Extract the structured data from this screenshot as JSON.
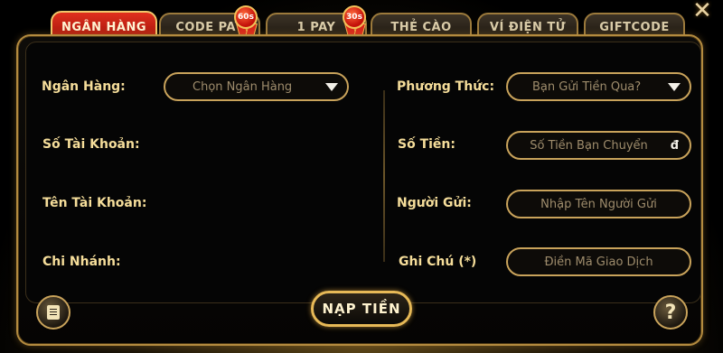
{
  "tabs": [
    {
      "label": "NGÂN HÀNG",
      "active": true
    },
    {
      "label": "CODE PAY",
      "badge": "60s"
    },
    {
      "label": "1 PAY",
      "badge": "30s"
    },
    {
      "label": "THẺ CÀO"
    },
    {
      "label": "VÍ ĐIỆN TỬ"
    },
    {
      "label": "GIFTCODE"
    }
  ],
  "close_icon": "close-icon",
  "form": {
    "bank_label": "Ngân Hàng:",
    "bank_select": "Chọn Ngân Hàng",
    "account_number_label": "Số Tài Khoản:",
    "account_name_label": "Tên Tài Khoản:",
    "branch_label": "Chi Nhánh:",
    "method_label": "Phương Thức:",
    "method_select": "Bạn Gửi Tiền Qua?",
    "amount_label": "Số Tiền:",
    "amount_placeholder": "Số Tiền Bạn Chuyển",
    "amount_suffix": "đ",
    "sender_label": "Người Gửi:",
    "sender_placeholder": "Nhập Tên Người Gửi",
    "note_label": "Ghi Chú (*)",
    "note_placeholder": "Điền Mã Giao Dịch"
  },
  "buttons": {
    "submit": "NẠP TIỀN",
    "help": "?",
    "history_icon": "document-icon"
  },
  "colors": {
    "accent_gold": "#c9a35b",
    "label_gold": "#f5dd9a",
    "active_tab_red": "#d8251a"
  }
}
